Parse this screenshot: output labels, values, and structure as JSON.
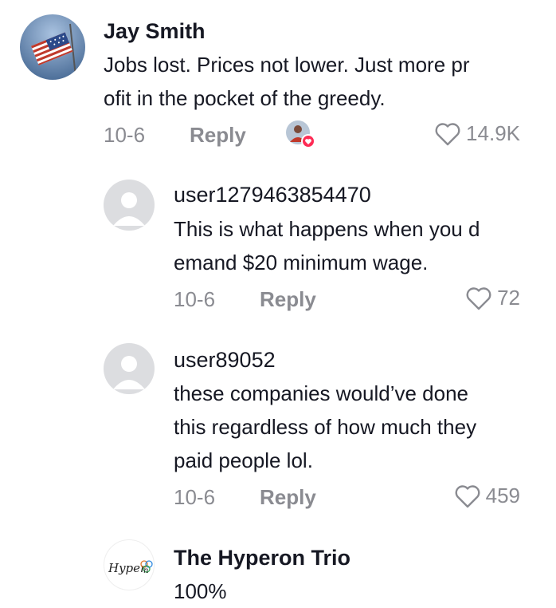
{
  "comments": [
    {
      "username": "Jay Smith",
      "text_lines": [
        "Jobs lost. Prices not lower. Just more pr",
        "ofit in the pocket of the greedy."
      ],
      "date": "10-6",
      "reply_label": "Reply",
      "likes": "14.9K",
      "avatar_icon": "us-flag-avatar"
    },
    {
      "username": "user1279463854470",
      "text_lines": [
        "This is what happens when you d",
        "emand $20 minimum wage."
      ],
      "date": "10-6",
      "reply_label": "Reply",
      "likes": "72",
      "avatar_icon": "default-user-avatar"
    },
    {
      "username": "user89052",
      "text_lines": [
        "these companies would’ve done",
        "this regardless of how much they",
        "paid people lol."
      ],
      "date": "10-6",
      "reply_label": "Reply",
      "likes": "459",
      "avatar_icon": "default-user-avatar"
    },
    {
      "username": "The Hyperon Trio",
      "text_lines": [
        "100%"
      ],
      "avatar_icon": "hyperon-logo-avatar",
      "logo_text": "Hyperon"
    }
  ],
  "colors": {
    "text": "#161823",
    "muted": "#8a8b91",
    "creator_badge": "#fe2c55"
  }
}
